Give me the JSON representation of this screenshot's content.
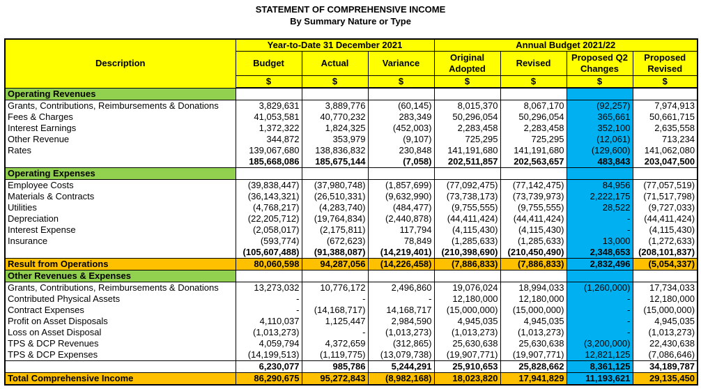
{
  "header": {
    "title": "STATEMENT OF COMPREHENSIVE INCOME",
    "subtitle": "By Summary Nature or Type"
  },
  "columns": {
    "description": "Description",
    "ytd_group": "Year-to-Date 31 December 2021",
    "annual_group": "Annual Budget 2021/22",
    "budget": "Budget",
    "actual": "Actual",
    "variance": "Variance",
    "original": "Original Adopted",
    "revised": "Revised",
    "proposed_q2": "Proposed Q2 Changes",
    "proposed_revised": "Proposed Revised",
    "currency": "$"
  },
  "sections": [
    {
      "title": "Operating Revenues",
      "rows": [
        [
          "Grants, Contributions, Reimbursements & Donations",
          "3,829,631",
          "3,889,776",
          "(60,145)",
          "8,015,370",
          "8,067,170",
          "(92,257)",
          "7,974,913"
        ],
        [
          "Fees & Charges",
          "41,053,581",
          "40,770,232",
          "283,349",
          "50,296,054",
          "50,296,054",
          "365,661",
          "50,661,715"
        ],
        [
          "Interest Earnings",
          "1,372,322",
          "1,824,325",
          "(452,003)",
          "2,283,458",
          "2,283,458",
          "352,100",
          "2,635,558"
        ],
        [
          "Other Revenue",
          "344,872",
          "353,979",
          "(9,107)",
          "725,295",
          "725,295",
          "(12,061)",
          "713,234"
        ],
        [
          "Rates",
          "139,067,680",
          "138,836,832",
          "230,848",
          "141,191,680",
          "141,191,680",
          "(129,600)",
          "141,062,080"
        ]
      ],
      "total": [
        "",
        "185,668,086",
        "185,675,144",
        "(7,058)",
        "202,511,857",
        "202,563,657",
        "483,843",
        "203,047,500"
      ]
    },
    {
      "title": "Operating Expenses",
      "rows": [
        [
          "Employee Costs",
          "(39,838,447)",
          "(37,980,748)",
          "(1,857,699)",
          "(77,092,475)",
          "(77,142,475)",
          "84,956",
          "(77,057,519)"
        ],
        [
          "Materials & Contracts",
          "(36,143,321)",
          "(26,510,331)",
          "(9,632,990)",
          "(73,738,173)",
          "(73,739,973)",
          "2,222,175",
          "(71,517,798)"
        ],
        [
          "Utilities",
          "(4,768,217)",
          "(4,283,740)",
          "(484,477)",
          "(9,755,555)",
          "(9,755,555)",
          "28,522",
          "(9,727,033)"
        ],
        [
          "Depreciation",
          "(22,205,712)",
          "(19,764,834)",
          "(2,440,878)",
          "(44,411,424)",
          "(44,411,424)",
          "-",
          "(44,411,424)"
        ],
        [
          "Interest Expense",
          "(2,058,017)",
          "(2,175,811)",
          "117,794",
          "(4,115,430)",
          "(4,115,430)",
          "-",
          "(4,115,430)"
        ],
        [
          "Insurance",
          "(593,774)",
          "(672,623)",
          "78,849",
          "(1,285,633)",
          "(1,285,633)",
          "13,000",
          "(1,272,633)"
        ]
      ],
      "total": [
        "",
        "(105,607,488)",
        "(91,388,087)",
        "(14,219,401)",
        "(210,398,690)",
        "(210,450,490)",
        "2,348,653",
        "(208,101,837)"
      ]
    }
  ],
  "result_operations": [
    "Result from Operations",
    "80,060,598",
    "94,287,056",
    "(14,226,458)",
    "(7,886,833)",
    "(7,886,833)",
    "2,832,496",
    "(5,054,337)"
  ],
  "other_section": {
    "title": "Other Revenues & Expenses",
    "rows": [
      [
        "Grants, Contributions, Reimbursements & Donations",
        "13,273,032",
        "10,776,172",
        "2,496,860",
        "19,076,024",
        "18,994,033",
        "(1,260,000)",
        "17,734,033"
      ],
      [
        "Contributed Physical Assets",
        "-",
        "-",
        "-",
        "12,180,000",
        "12,180,000",
        "-",
        "12,180,000"
      ],
      [
        "Contract Expenses",
        "-",
        "(14,168,717)",
        "14,168,717",
        "(15,000,000)",
        "(15,000,000)",
        "-",
        "(15,000,000)"
      ],
      [
        "Profit on Asset Disposals",
        "4,110,037",
        "1,125,447",
        "2,984,590",
        "4,945,035",
        "4,945,035",
        "-",
        "4,945,035"
      ],
      [
        "Loss on Asset Disposal",
        "(1,013,273)",
        "-",
        "(1,013,273)",
        "(1,013,273)",
        "(1,013,273)",
        "-",
        "(1,013,273)"
      ],
      [
        "TPS & DCP Revenues",
        "4,059,794",
        "4,372,659",
        "(312,865)",
        "25,630,638",
        "25,630,638",
        "(3,200,000)",
        "22,430,638"
      ],
      [
        "TPS & DCP Expenses",
        "(14,199,513)",
        "(1,119,775)",
        "(13,079,738)",
        "(19,907,771)",
        "(19,907,771)",
        "12,821,125",
        "(7,086,646)"
      ]
    ],
    "total": [
      "",
      "6,230,077",
      "985,786",
      "5,244,291",
      "25,910,653",
      "25,828,662",
      "8,361,125",
      "34,189,787"
    ]
  },
  "total_comprehensive": [
    "Total Comprehensive Income",
    "86,290,675",
    "95,272,843",
    "(8,982,168)",
    "18,023,820",
    "17,941,829",
    "11,193,621",
    "29,135,450"
  ],
  "colors": {
    "header_yellow": "#ffff00",
    "section_green": "#92d050",
    "result_orange": "#ffc000",
    "highlight_blue": "#00b0f0"
  }
}
